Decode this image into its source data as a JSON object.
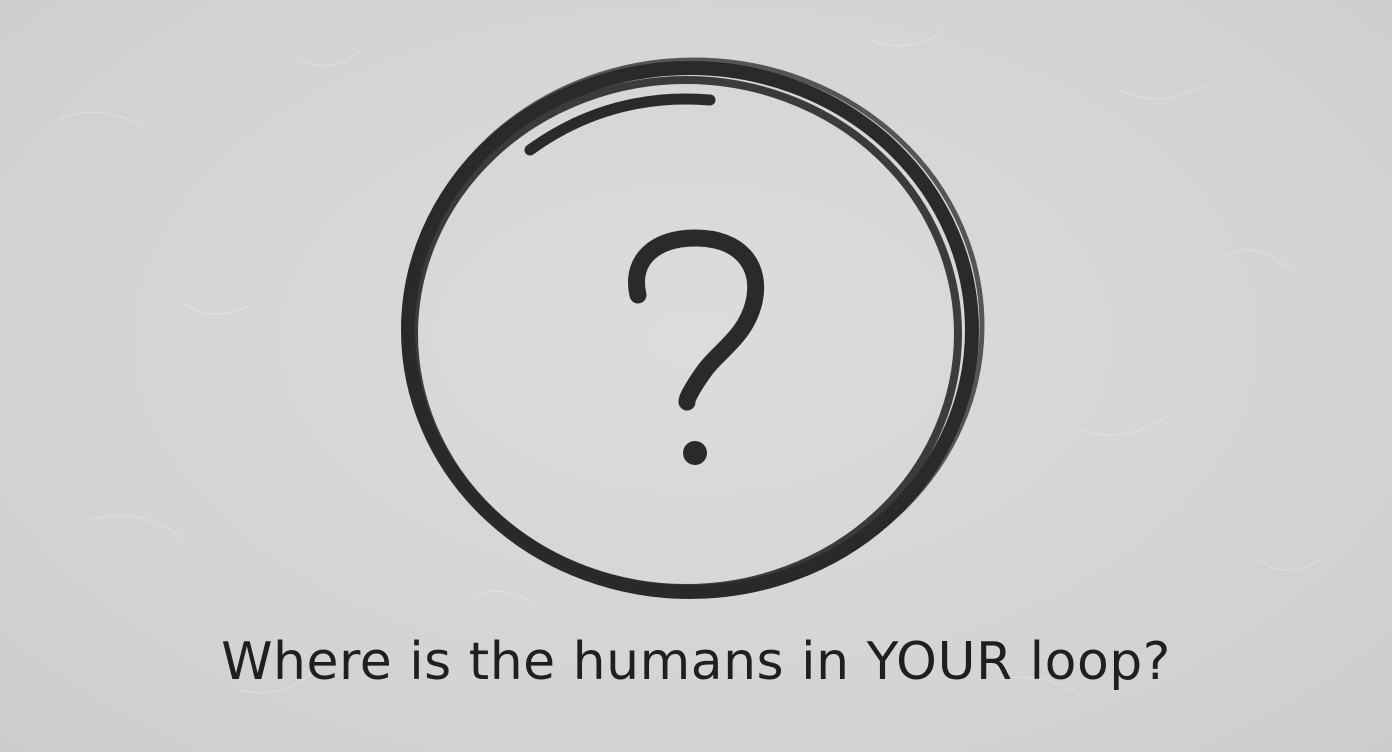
{
  "caption": "Where is the humans in YOUR loop?",
  "figure": {
    "icon": "hand-drawn-circled-question-mark",
    "glyph": "?"
  },
  "colors": {
    "background": "#d6d6d5",
    "ink": "#2a2a2a",
    "text": "#1f1f1f"
  }
}
